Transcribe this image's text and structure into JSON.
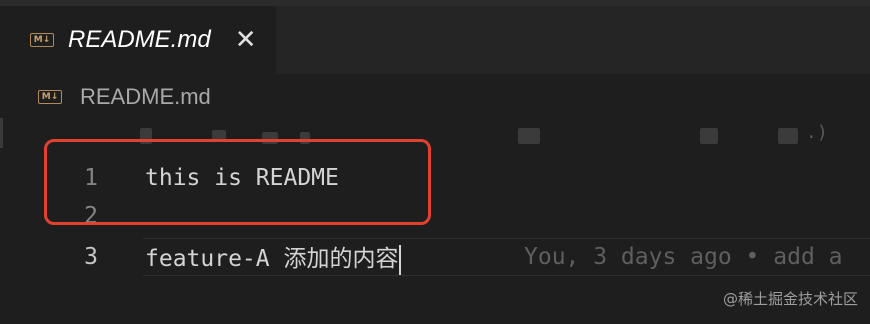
{
  "tab": {
    "icon": "markdown-icon",
    "icon_text": "M↓",
    "title": "README.md",
    "close_glyph": "✕"
  },
  "breadcrumb": {
    "icon": "markdown-icon",
    "icon_text": "M↓",
    "label": "README.md"
  },
  "editor": {
    "lines": [
      {
        "number": "1",
        "text": "this is README"
      },
      {
        "number": "2",
        "text": ""
      },
      {
        "number": "3",
        "text": "feature-A 添加的内容"
      }
    ],
    "blame_inline": "You, 3 days ago • add a",
    "blame_header_tail": ".)"
  },
  "colors": {
    "annotation_box": "#e2412e",
    "markdown_icon": "#c6a06c"
  },
  "watermark": "@稀土掘金技术社区"
}
